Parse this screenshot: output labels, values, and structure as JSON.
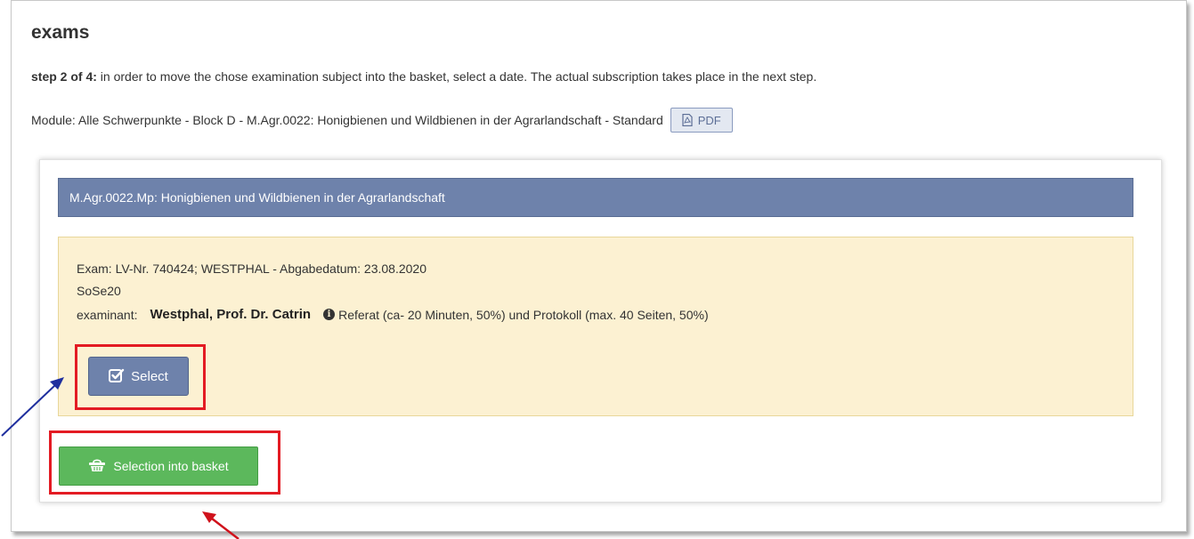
{
  "page": {
    "title": "exams",
    "step_label": "step 2 of 4:",
    "step_text": " in order to move the chose examination subject into the basket, select a date. The actual subscription takes place in the next step.",
    "module_text": "Module: Alle Schwerpunkte - Block D - M.Agr.0022: Honigbienen und Wildbienen in der Agrarlandschaft - Standard",
    "pdf_label": "PDF"
  },
  "card": {
    "module_header": "M.Agr.0022.Mp: Honigbienen und Wildbienen in der Agrarlandschaft",
    "exam": {
      "title": "Exam: LV-Nr. 740424; WESTPHAL - Abgabedatum: 23.08.2020",
      "semester": "SoSe20",
      "examinant_label": "examinant:",
      "examinant_name": "Westphal, Prof. Dr. Catrin",
      "info_icon_glyph": "i",
      "description": "Referat (ca- 20 Minuten, 50%) und Protokoll (max. 40 Seiten, 50%)",
      "select_label": "Select"
    },
    "basket_label": "Selection into basket"
  },
  "icons": {
    "pdf": "pdf-file-icon",
    "select": "checkbox-icon",
    "basket": "basket-icon",
    "info": "info-circle-icon"
  },
  "colors": {
    "primary": "#6e82ab",
    "success": "#5cb85c",
    "exam_bg": "#fcf1d2",
    "highlight": "#e31b23",
    "arrow_blue": "#1f2f9e",
    "arrow_red": "#d0121b"
  }
}
